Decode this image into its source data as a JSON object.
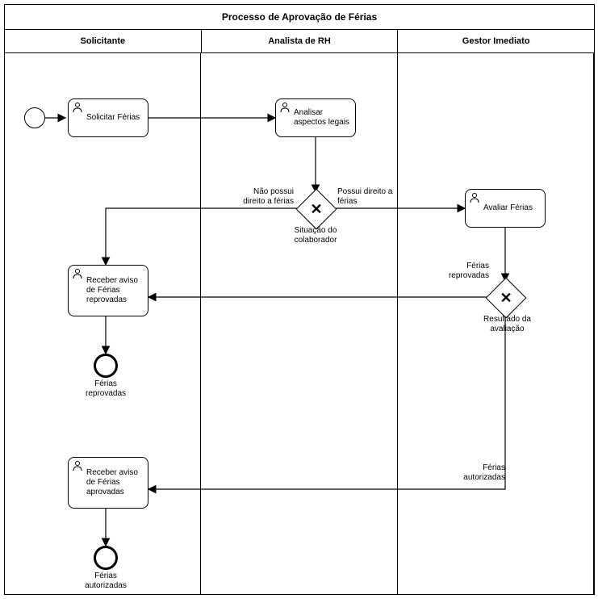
{
  "title": "Processo de Aprovação de Férias",
  "lanes": [
    "Solicitante",
    "Analista de RH",
    "Gestor Imediato"
  ],
  "tasks": {
    "t1": "Solicitar Férias",
    "t2": "Analisar aspectos legais",
    "t3": "Avaliar Férias",
    "t4": "Receber aviso de Férias reprovadas",
    "t5": "Receber aviso de Férias aprovadas"
  },
  "gateways": {
    "g1": "Situação do colaborador",
    "g2": "Resultado da avaliação"
  },
  "edges": {
    "e1": "Não possui direito a férias",
    "e2": "Possui direito a férias",
    "e3": "Férias reprovadas",
    "e4": "Férias autorizadas"
  },
  "ends": {
    "end1": "Férias reprovadas",
    "end2": "Férias autorizadas"
  }
}
